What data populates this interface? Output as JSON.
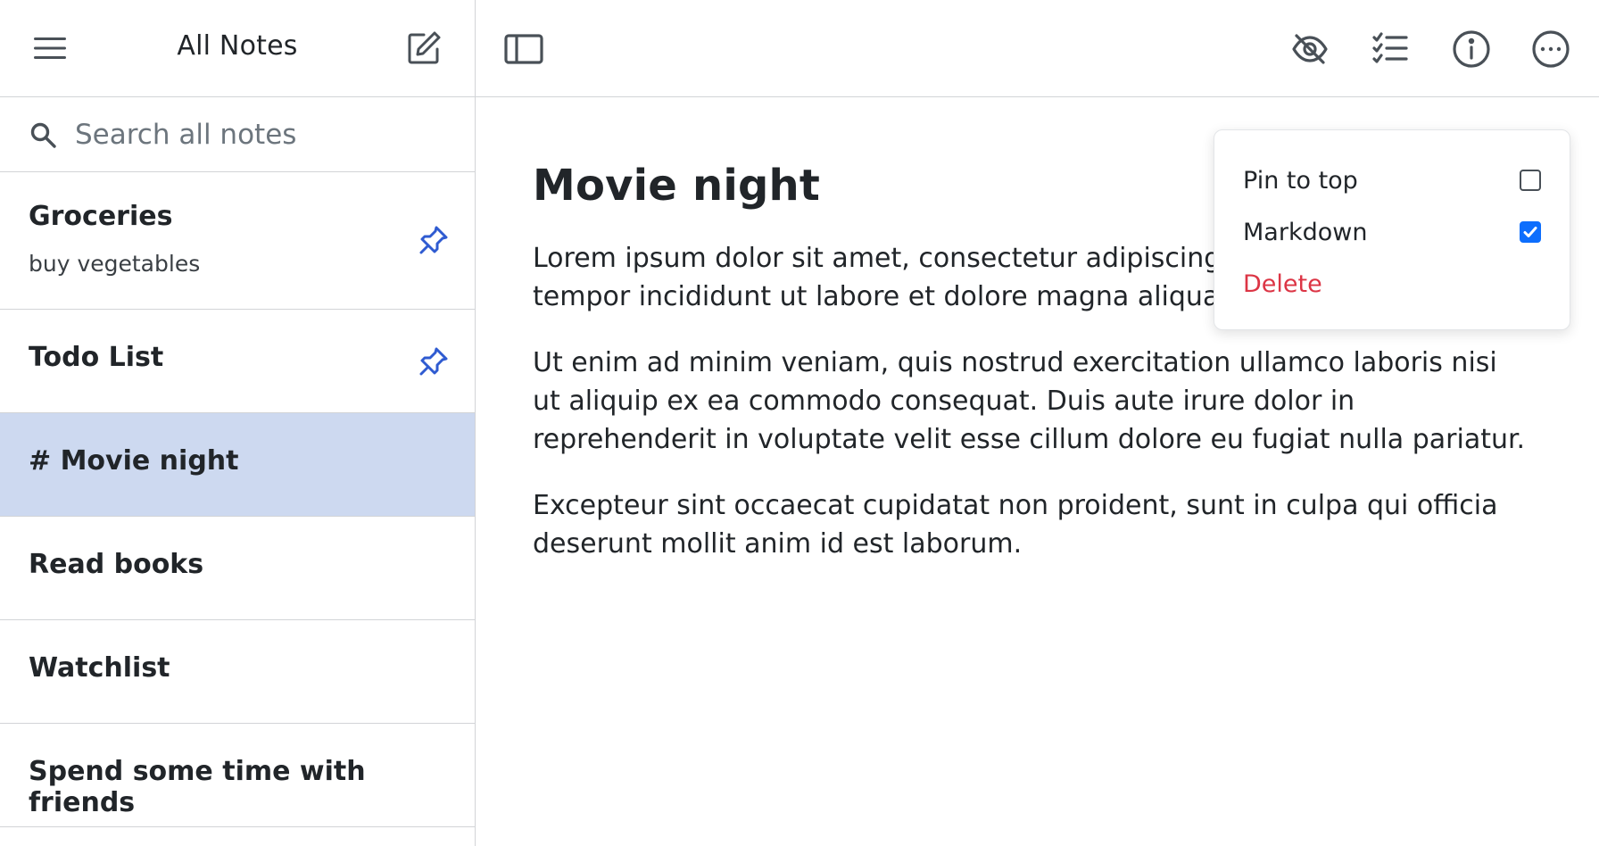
{
  "sidebar": {
    "title": "All Notes",
    "menu_icon": "hamburger-menu-icon",
    "compose_icon": "compose-note-icon",
    "search": {
      "placeholder": "Search all notes",
      "value": "",
      "icon": "search-icon"
    },
    "notes": [
      {
        "title": "Groceries",
        "subtitle": "buy vegetables",
        "pinned": true,
        "active": false
      },
      {
        "title": "Todo List",
        "subtitle": "",
        "pinned": true,
        "active": false
      },
      {
        "title": "# Movie night",
        "subtitle": "",
        "pinned": false,
        "active": true
      },
      {
        "title": "Read books",
        "subtitle": "",
        "pinned": false,
        "active": false
      },
      {
        "title": "Watchlist",
        "subtitle": "",
        "pinned": false,
        "active": false
      },
      {
        "title": "Spend some time with friends",
        "subtitle": "",
        "pinned": false,
        "active": false
      }
    ]
  },
  "toolbar": {
    "icons": [
      "sidebar-toggle-icon",
      "eye-slash-icon",
      "checklist-icon",
      "info-icon",
      "more-options-icon"
    ]
  },
  "editor": {
    "heading": "Movie night",
    "paragraphs": [
      "Lorem ipsum dolor sit amet, consectetur adipiscing elit, sed do eiusmod tempor incididunt ut labore et dolore magna aliqua.",
      "Ut enim ad minim veniam, quis nostrud exercitation ullamco laboris nisi ut aliquip ex ea commodo consequat. Duis aute irure dolor in reprehenderit in voluptate velit esse cillum dolore eu fugiat nulla pariatur.",
      "Excepteur sint occaecat cupidatat non proident, sunt in culpa qui officia deserunt mollit anim id est laborum."
    ]
  },
  "dropdown": {
    "pin_label": "Pin to top",
    "pin_checked": false,
    "markdown_label": "Markdown",
    "markdown_checked": true,
    "delete_label": "Delete"
  },
  "colors": {
    "accent": "#0d6efd",
    "pin": "#2f5bd1",
    "active_row": "#cdd9f0",
    "danger": "#dc3545",
    "border": "#d2d4d7"
  }
}
